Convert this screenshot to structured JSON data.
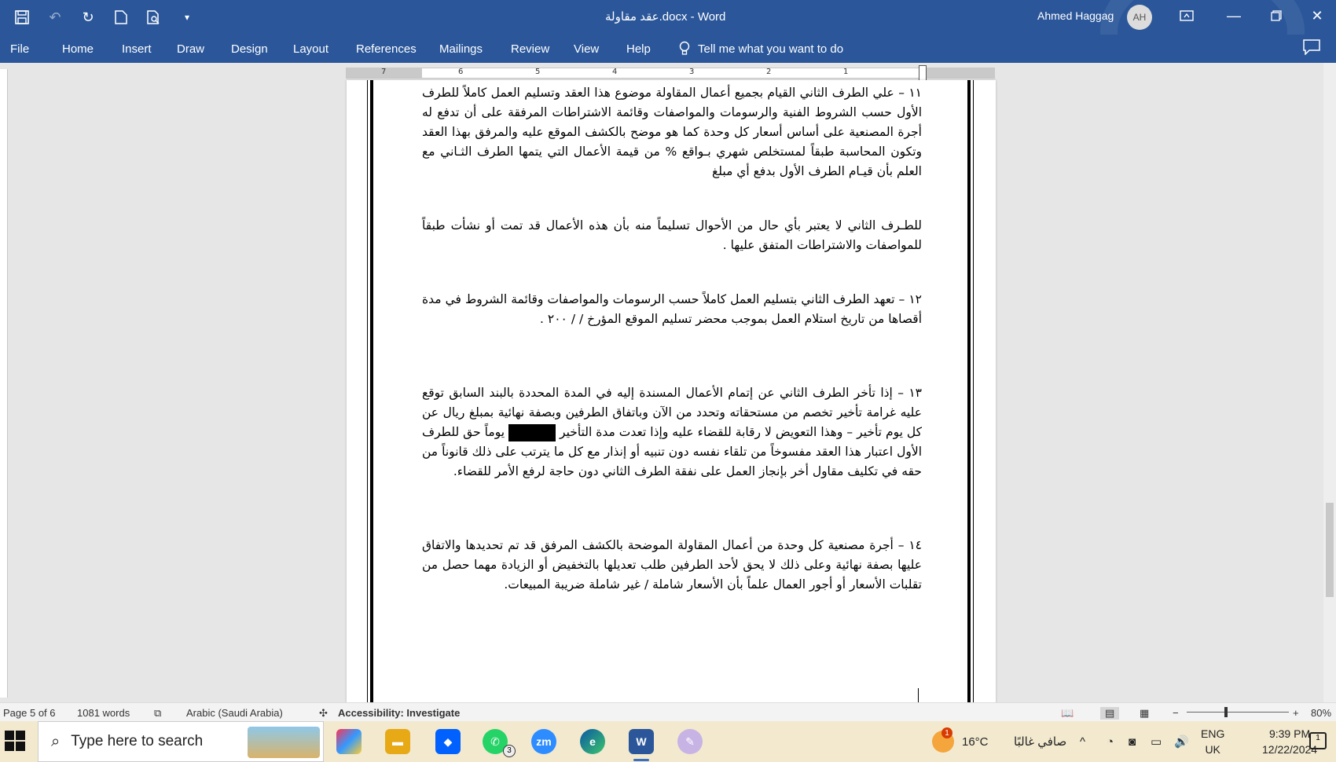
{
  "titlebar": {
    "doc_title": "عقد مقاولة.docx  -  Word",
    "user_name": "Ahmed Haggag",
    "user_initials": "AH",
    "bg_color": "#2b579a"
  },
  "qat": {
    "save_icon": "save-icon",
    "undo_icon": "undo-icon",
    "redo_icon": "redo-icon",
    "new_icon": "new-document-icon",
    "preview_icon": "print-preview-icon",
    "customize_icon": "customize-qat-icon"
  },
  "ribbon": {
    "tabs": [
      "File",
      "Home",
      "Insert",
      "Draw",
      "Design",
      "Layout",
      "References",
      "Mailings",
      "Review",
      "View",
      "Help"
    ],
    "tell_me": "Tell me what you want to do"
  },
  "ruler": {
    "ticks": [
      "7",
      "6",
      "5",
      "4",
      "3",
      "2",
      "1"
    ]
  },
  "document": {
    "paragraphs": [
      "١١ – علي الطرف الثاني القيام بجميع أعمال المقاولة موضوع هذا العقد وتسليم العمل كاملاً للطرف الأول حسب الشروط الفنية والرسومات والمواصفات وقائمة الاشتراطات المرفقة على أن تدفع له أجرة المصنعية على أساس أسعار كل وحدة كما هو موضح بالكشف الموقع عليه والمرفق بهذا العقد وتكون المحاسبة طبقاً لمستخلص شهري بـواقع         % من قيمة الأعمال التي يتمها الطرف الثـاني مع العلم بأن قيـام الطرف الأول بدفع أي مبلغ",
      "للطـرف الثاني لا يعتبر بأي حال من الأحوال تسليماً منه بأن هذه الأعمال قد تمت أو نشأت طبقاً للمواصفات والاشتراطات المتفق عليها .",
      "١٢ – تعهد الطرف الثاني بتسليم العمل كاملاً حسب الرسومات والمواصفات وقائمة الشروط في مدة أقصاها                       من تاريخ استلام العمل بموجب محضر تسليم الموقع المؤرخ      /     /  ٢٠٠ .",
      "١٣ – إذا تأخر الطرف الثاني عن إتمام الأعمال المسندة إليه في المدة المحددة بالبند السابق توقع عليه غرامة تأخير تخصم من مستحقاته وتحدد من الآن وباتفاق الطرفين وبصفة نهائية بمبلغ                ريال عن كل يوم تأخير – وهذا التعويض لا رقابة للقضاء عليه وإذا تعدت مدة التأخير",
      "يوماً حق للطرف الأول اعتبار هذا العقد مفسوخاً من تلقاء نفسه دون تنبيه أو إنذار مع كل ما يترتب على ذلك قانوناً من حقه في تكليف مقاول أخر بإنجاز العمل على نفقة الطرف الثاني دون حاجة لرفع الأمر للقضاء.",
      "١٤ – أجرة مصنعية كل وحدة من أعمال المقاولة الموضحة بالكشف المرفق قد تم تحديدها والاتفاق عليها بصفة نهائية وعلى ذلك لا يحق لأحد الطرفين طلب تعديلها بالتخفيض أو الزيادة مهما حصل من تقلبات الأسعار أو أجور العمال علماً بأن الأسعار شاملة / غير شاملة ضريبة المبيعات."
    ]
  },
  "statusbar": {
    "page": "Page 5 of 6",
    "words": "1081 words",
    "language": "Arabic (Saudi Arabia)",
    "accessibility": "Accessibility: Investigate",
    "zoom": "80%",
    "zoom_level": 0.8
  },
  "taskbar": {
    "search_placeholder": "Type here to search",
    "whatsapp_count": "3",
    "weather_badge": "1",
    "temperature": "16°C",
    "weather_text": "صافي غالبًا",
    "lang_top": "ENG",
    "lang_bottom": "UK",
    "time": "9:39 PM",
    "date": "12/22/2024",
    "notif_count": "1"
  }
}
